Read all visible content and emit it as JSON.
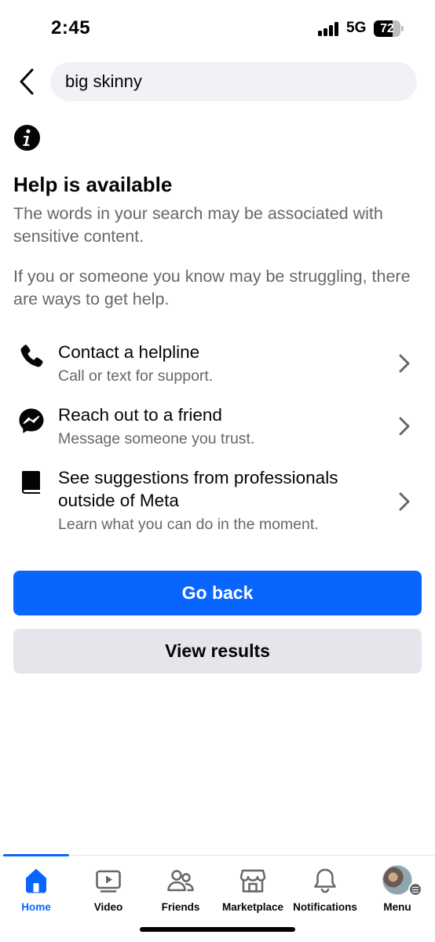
{
  "status_bar": {
    "time": "2:45",
    "network": "5G",
    "battery": "72",
    "battery_level": 0.72
  },
  "search": {
    "query": "big skinny"
  },
  "help": {
    "title": "Help is available",
    "description1": "The words in your search may be associated with sensitive content.",
    "description2": "If you or someone you know may be struggling, there are ways to get help."
  },
  "options": [
    {
      "icon": "phone-icon",
      "title": "Contact a helpline",
      "subtitle": "Call or text for support."
    },
    {
      "icon": "messenger-icon",
      "title": "Reach out to a friend",
      "subtitle": "Message someone you trust."
    },
    {
      "icon": "book-icon",
      "title": "See suggestions from professionals outside of Meta",
      "subtitle": "Learn what you can do in the moment."
    }
  ],
  "actions": {
    "go_back": "Go back",
    "view_results": "View results"
  },
  "tabs": [
    {
      "label": "Home",
      "icon": "home-icon",
      "active": true
    },
    {
      "label": "Video",
      "icon": "video-icon",
      "active": false
    },
    {
      "label": "Friends",
      "icon": "friends-icon",
      "active": false
    },
    {
      "label": "Marketplace",
      "icon": "marketplace-icon",
      "active": false
    },
    {
      "label": "Notifications",
      "icon": "bell-icon",
      "active": false
    },
    {
      "label": "Menu",
      "icon": "avatar",
      "active": false
    }
  ],
  "colors": {
    "accent": "#0866ff",
    "secondary_button": "#e4e6eb",
    "muted_text": "#65676b",
    "search_bg": "#f0f2f5"
  }
}
